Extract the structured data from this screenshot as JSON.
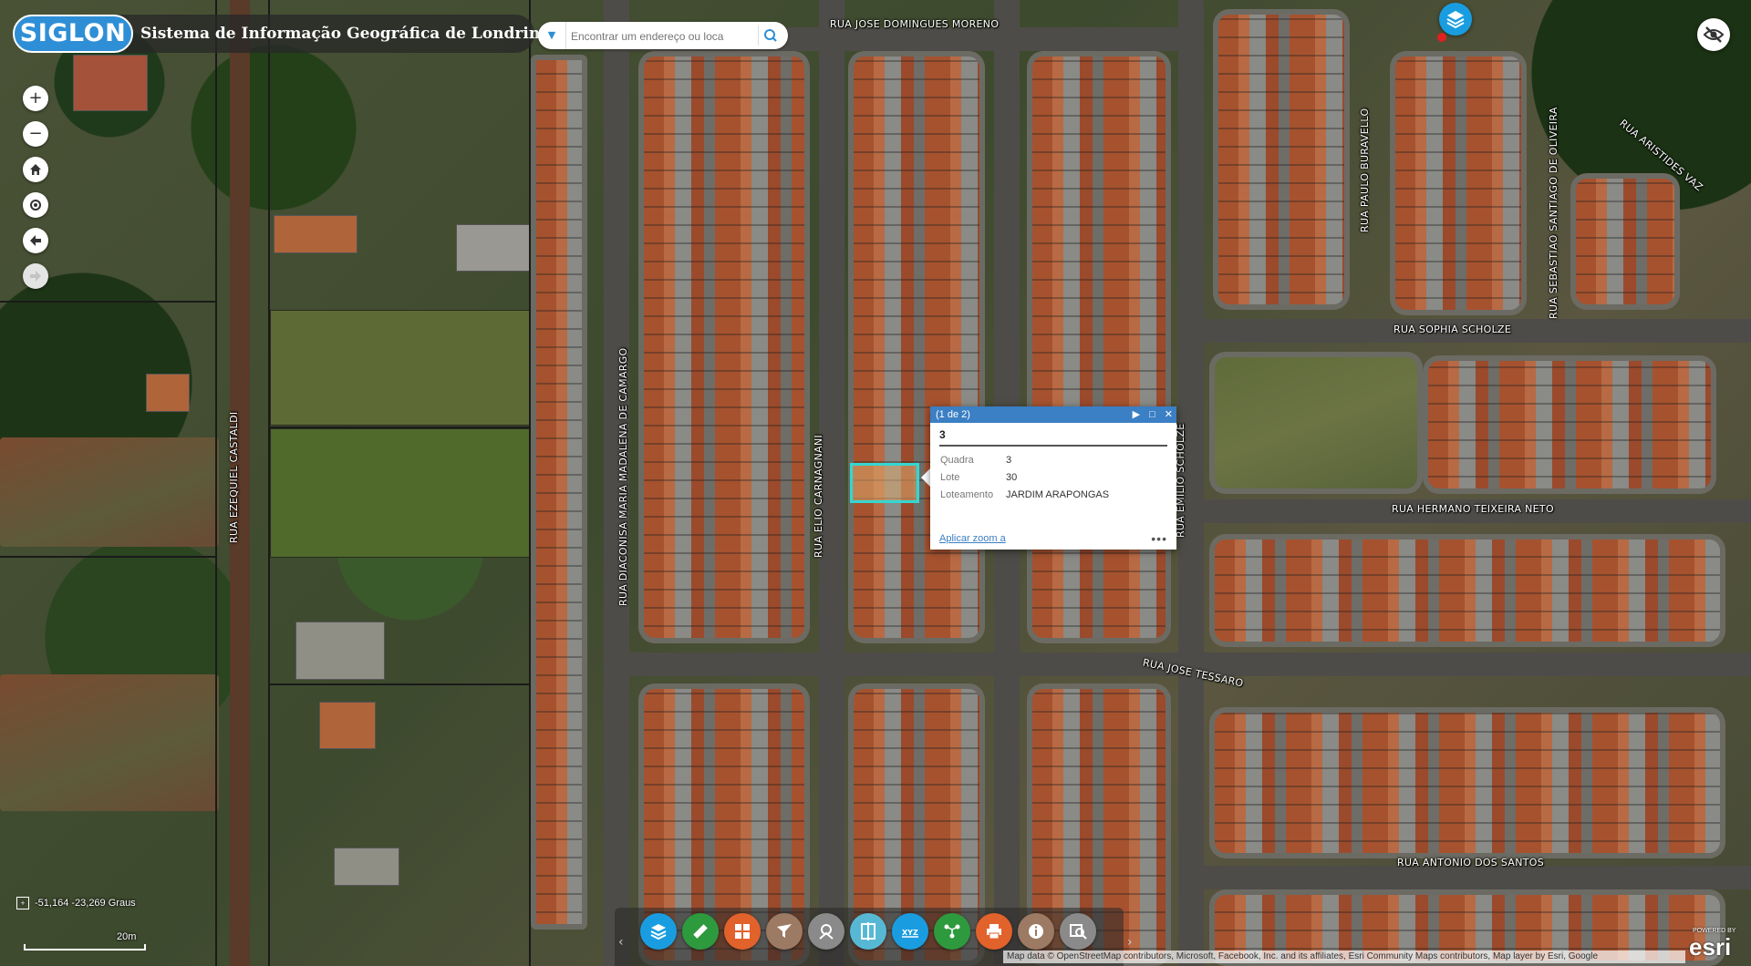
{
  "header": {
    "logo_text": "SIGLON",
    "title": "Sistema de Informação Geográfica de Londrina"
  },
  "search": {
    "placeholder": "Encontrar um endereço ou loca"
  },
  "map_controls": {
    "zoom_in": "+",
    "zoom_out": "−",
    "home": "⌂",
    "locate": "◎",
    "back": "⬅",
    "forward": "➡"
  },
  "streets": [
    "RUA JOSE DOMINGUES MORENO",
    "RUA PAULO BURAVELLO",
    "RUA SEBASTIAO SANTIAGO DE OLIVEIRA",
    "RUA ARISTIDES VAZ",
    "RUA SOPHIA SCHOLZE",
    "RUA DIACONISA MARIA MADALENA DE CAMARGO",
    "RUA ELIO CARNAGNANI",
    "RUA EMILIO SCHOLZE",
    "RUA EZEQUIEL CASTALDI",
    "RUA HERMANO TEIXEIRA NETO",
    "RUA JOSE TESSARO",
    "RUA ANTONIO DOS SANTOS"
  ],
  "popup": {
    "pager": "(1 de 2)",
    "title": "3",
    "fields": [
      {
        "key": "Quadra",
        "value": "3"
      },
      {
        "key": "Lote",
        "value": "30"
      },
      {
        "key": "Loteamento",
        "value": "JARDIM ARAPONGAS"
      }
    ],
    "zoom_link": "Aplicar zoom a",
    "more": "•••"
  },
  "toolbar": {
    "buttons": [
      {
        "name": "layers",
        "color": "#1a9de0"
      },
      {
        "name": "measure",
        "color": "#2e9a3e"
      },
      {
        "name": "basemap-gallery",
        "color": "#e2622b"
      },
      {
        "name": "filter",
        "color": "#9c7a63"
      },
      {
        "name": "draw",
        "color": "#8a8a8a"
      },
      {
        "name": "swipe",
        "color": "#57b8d4"
      },
      {
        "name": "coordinate",
        "color": "#1a9de0"
      },
      {
        "name": "share",
        "color": "#2e9a3e"
      },
      {
        "name": "print",
        "color": "#e2622b"
      },
      {
        "name": "about",
        "color": "#9c7a63"
      },
      {
        "name": "query",
        "color": "#8a8a8a"
      }
    ]
  },
  "coordinates": {
    "text": "-51,164 -23,269 Graus"
  },
  "scale": {
    "label": "20m"
  },
  "attribution": {
    "text": "Map data © OpenStreetMap contributors, Microsoft, Facebook, Inc. and its affiliates, Esri Community Maps contributors, Map layer by Esri, Google",
    "powered_by": "POWERED BY",
    "esri": "esri"
  },
  "colors": {
    "accent": "#2f8fd6",
    "popup_header": "#3b7fc4",
    "selection": "#35d6d0"
  }
}
